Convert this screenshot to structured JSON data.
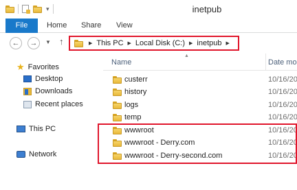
{
  "window": {
    "title": "inetpub"
  },
  "ribbon": {
    "tabs": [
      "File",
      "Home",
      "Share",
      "View"
    ]
  },
  "address": {
    "crumbs": [
      "This PC",
      "Local Disk (C:)",
      "inetpub"
    ]
  },
  "nav": {
    "favorites": "Favorites",
    "desktop": "Desktop",
    "downloads": "Downloads",
    "recent": "Recent places",
    "thispc": "This PC",
    "network": "Network"
  },
  "columns": {
    "name": "Name",
    "date": "Date mo"
  },
  "files": [
    {
      "name": "custerr",
      "date": "10/16/20"
    },
    {
      "name": "history",
      "date": "10/16/20"
    },
    {
      "name": "logs",
      "date": "10/16/20"
    },
    {
      "name": "temp",
      "date": "10/16/20"
    },
    {
      "name": "wwwroot",
      "date": "10/16/20"
    },
    {
      "name": "wwwroot - Derry.com",
      "date": "10/16/20"
    },
    {
      "name": "wwwroot - Derry-second.com",
      "date": "10/16/20"
    }
  ],
  "colors": {
    "accent": "#1979ca",
    "highlight": "#e0142a"
  }
}
